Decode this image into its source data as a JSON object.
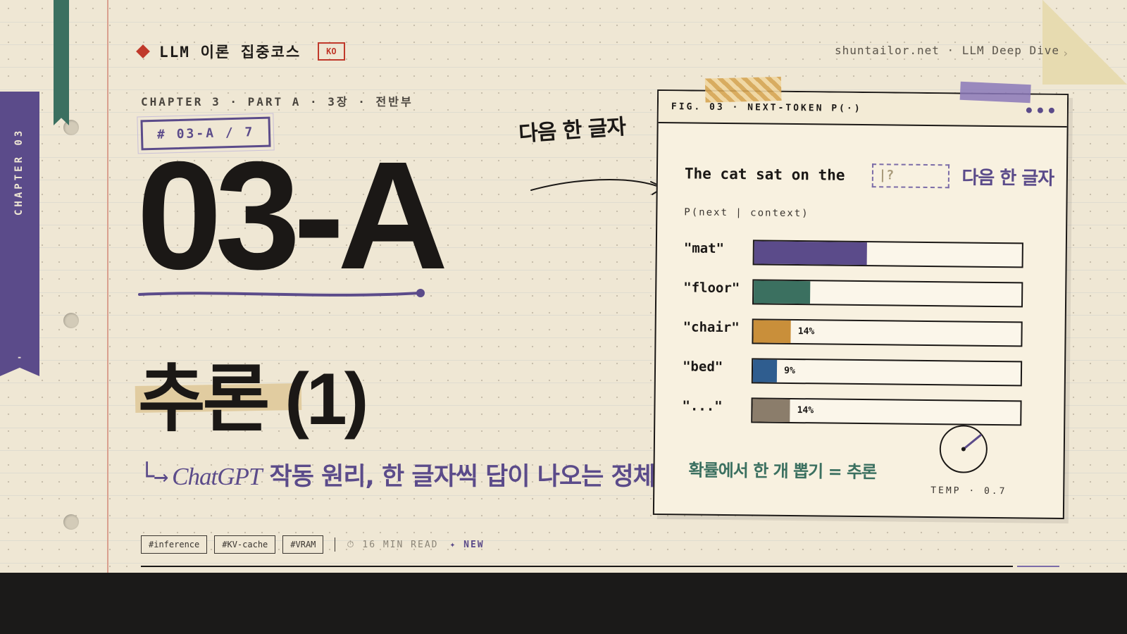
{
  "side_tab": {
    "label": "CHAPTER 03",
    "dash": "-"
  },
  "header": {
    "brand": "LLM 이론 집중코스",
    "lang_badge": "KO",
    "site": "shuntailor.net · LLM Deep Dive",
    "site_arrow": "›"
  },
  "hero": {
    "kicker": "CHAPTER 3 · PART A  ·  3장 · 전반부",
    "stamp": "# 03-A / 7",
    "code": "03-A",
    "title": "추론 (1)",
    "subtitle_arrow": "└→",
    "subtitle_em": "ChatGPT",
    "subtitle_rest": " 작동 원리, 한 글자씩 답이 나오는 정체"
  },
  "handnote": "다음 한 글자",
  "figure": {
    "title": "FIG. 03 · NEXT-TOKEN P(·)",
    "prompt": "The cat sat on the",
    "blank": "|?",
    "prompt_note": "다음 한 글자",
    "prob_label": "P(next | context)",
    "footer": "확률에서 한 개 뽑기 = 추론",
    "temp": "TEMP · 0.7"
  },
  "chart_data": {
    "type": "bar",
    "categories": [
      "\"mat\"",
      "\"floor\"",
      "\"chair\"",
      "\"bed\"",
      "\"...\""
    ],
    "values": [
      42,
      21,
      14,
      9,
      14
    ],
    "value_labels": [
      "",
      "",
      "14%",
      "9%",
      "14%"
    ],
    "colors": [
      "#5b4b8a",
      "#3b7060",
      "#c98f3a",
      "#2f5d8f",
      "#8b7d6b"
    ],
    "ylim": [
      0,
      100
    ]
  },
  "tags": [
    "#inference",
    "#KV-cache",
    "#VRAM"
  ],
  "meta": {
    "read": "⏱ 16 MIN READ",
    "new": "✦ NEW"
  }
}
